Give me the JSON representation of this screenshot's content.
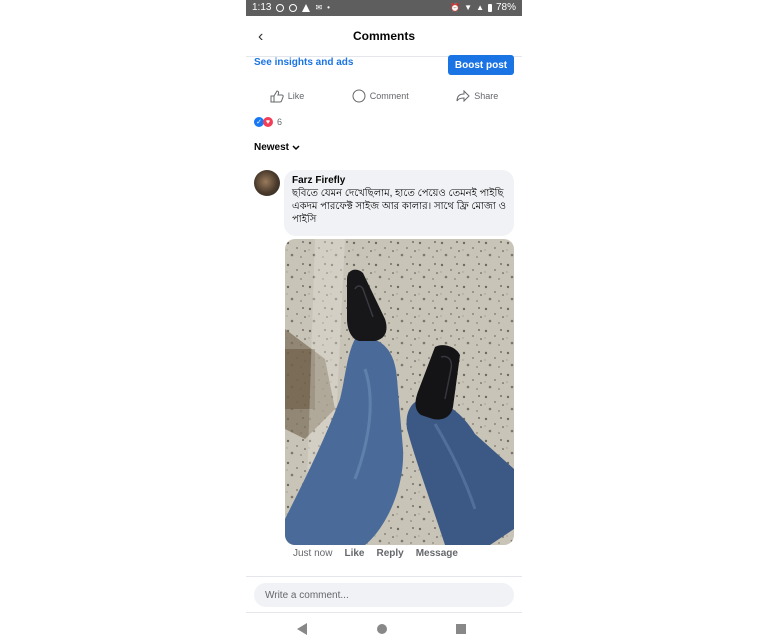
{
  "status_bar": {
    "time": "1:13",
    "battery": "78%"
  },
  "header": {
    "title": "Comments"
  },
  "post_bar": {
    "insights_label": "See insights and ads",
    "boost_label": "Boost post"
  },
  "actions": {
    "like": "Like",
    "comment": "Comment",
    "share": "Share"
  },
  "reactions": {
    "count": "6"
  },
  "sort": {
    "label": "Newest"
  },
  "comment": {
    "author": "Farz Firefly",
    "text": "ছবিতে যেমন দেখেছিলাম, হাতে পেয়েও তেমনই পাইছি একদম পারফেক্ট সাইজ আর কালার। সাথে ফ্রি মোজা ও পাইসি",
    "time": "Just now",
    "like": "Like",
    "reply": "Reply",
    "message": "Message"
  },
  "composer": {
    "placeholder": "Write a comment..."
  },
  "colors": {
    "accent": "#1b74e4",
    "status_bar": "#5e5e5e",
    "bubble": "#f0f2f5"
  }
}
